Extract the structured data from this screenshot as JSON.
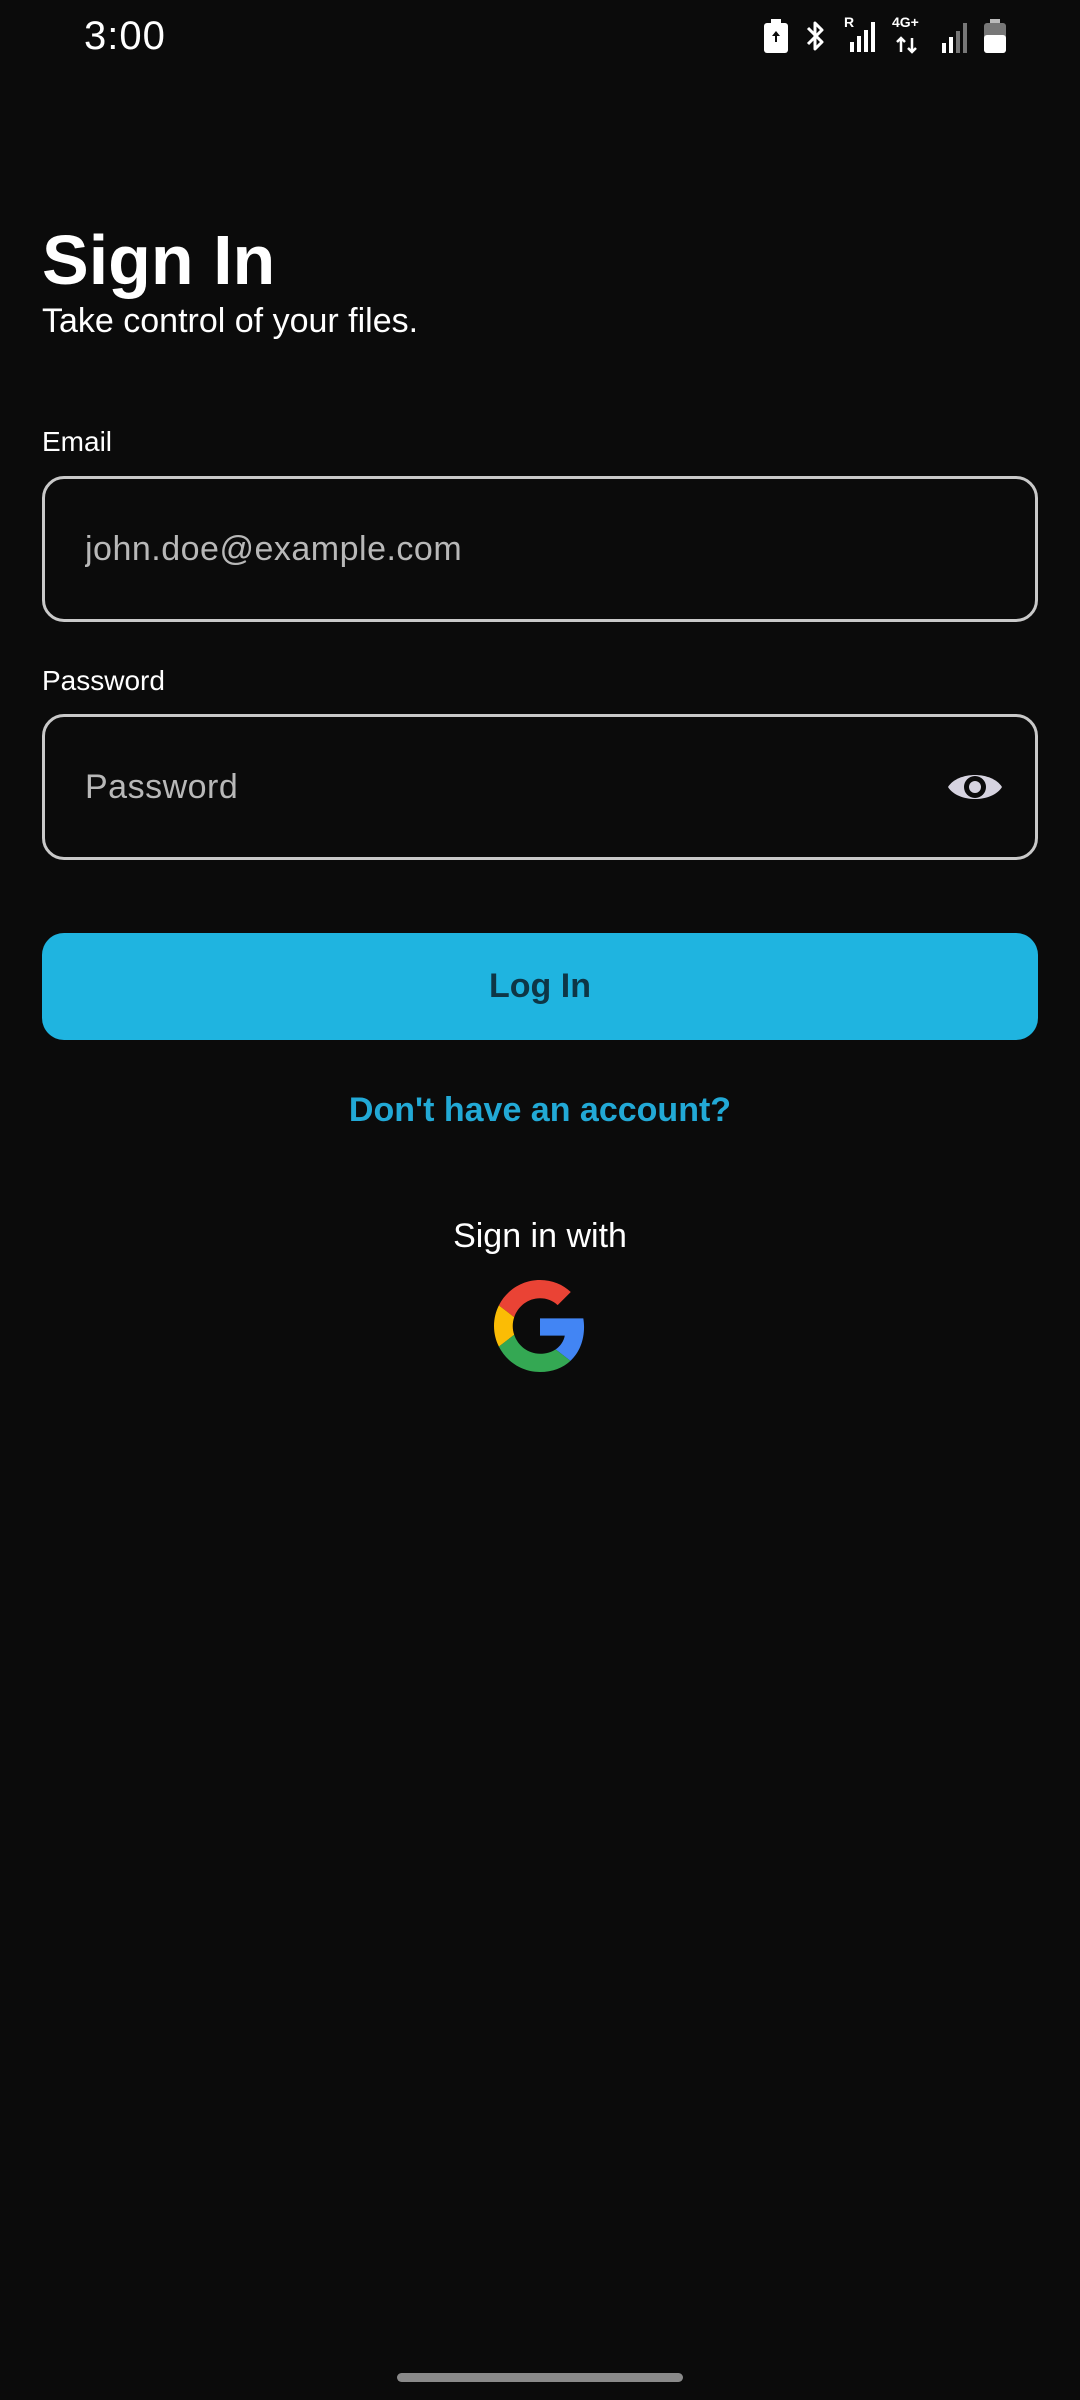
{
  "status_bar": {
    "time": "3:00",
    "network_badge": "4G+",
    "roaming_badge": "R",
    "icons": [
      "battery-saver-icon",
      "bluetooth-icon",
      "signal-roaming-icon",
      "mobile-data-icon",
      "signal-icon",
      "battery-icon"
    ]
  },
  "header": {
    "title": "Sign In",
    "subtitle": "Take control of your files."
  },
  "email": {
    "label": "Email",
    "value": "",
    "placeholder": "john.doe@example.com"
  },
  "password": {
    "label": "Password",
    "value": "",
    "placeholder": "Password",
    "toggle_icon": "eye-icon"
  },
  "actions": {
    "login_label": "Log In",
    "signup_link": "Don't have an account?",
    "sign_in_with": "Sign in with",
    "google_icon": "google-icon"
  },
  "colors": {
    "background": "#0b0b0b",
    "accent": "#1fb4e0",
    "link": "#22a9d6",
    "button_text": "#0e3646"
  }
}
